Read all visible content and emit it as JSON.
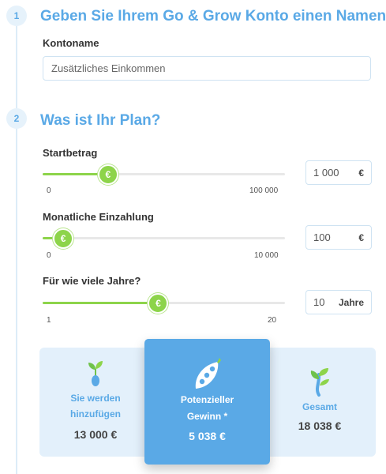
{
  "step1": {
    "number": "1",
    "title": "Geben Sie Ihrem Go & Grow Konto einen Namen",
    "field_label": "Kontoname",
    "field_value": "Zusätzliches Einkommen"
  },
  "step2": {
    "number": "2",
    "title": "Was ist Ihr Plan?"
  },
  "sliders": [
    {
      "label": "Startbetrag",
      "min_label": "0",
      "max_label": "100 000",
      "value_text": "1 000",
      "unit": "€",
      "thumb_symbol": "€",
      "fraction": 0.27
    },
    {
      "label": "Monatliche Einzahlung",
      "min_label": "0",
      "max_label": "10 000",
      "value_text": "100",
      "unit": "€",
      "thumb_symbol": "€",
      "fraction": 0.085
    },
    {
      "label": "Für wie viele Jahre?",
      "min_label": "1",
      "max_label": "20",
      "value_text": "10",
      "unit": "Jahre",
      "thumb_symbol": "€",
      "fraction": 0.477
    }
  ],
  "results": {
    "added": {
      "label_line1": "Sie werden",
      "label_line2": "hinzufügen",
      "value": "13 000 €"
    },
    "gain": {
      "label_line1": "Potenzieller",
      "label_line2": "Gewinn *",
      "value": "5 038 €"
    },
    "total": {
      "label": "Gesamt",
      "value": "18 038 €"
    }
  },
  "colors": {
    "accent_blue": "#5aa9e6",
    "accent_green": "#8dd44a",
    "panel_bg": "#e3f0fb"
  },
  "icons": {
    "added": "sprout-seed-icon",
    "gain": "pea-pod-icon",
    "total": "grown-plant-icon"
  }
}
